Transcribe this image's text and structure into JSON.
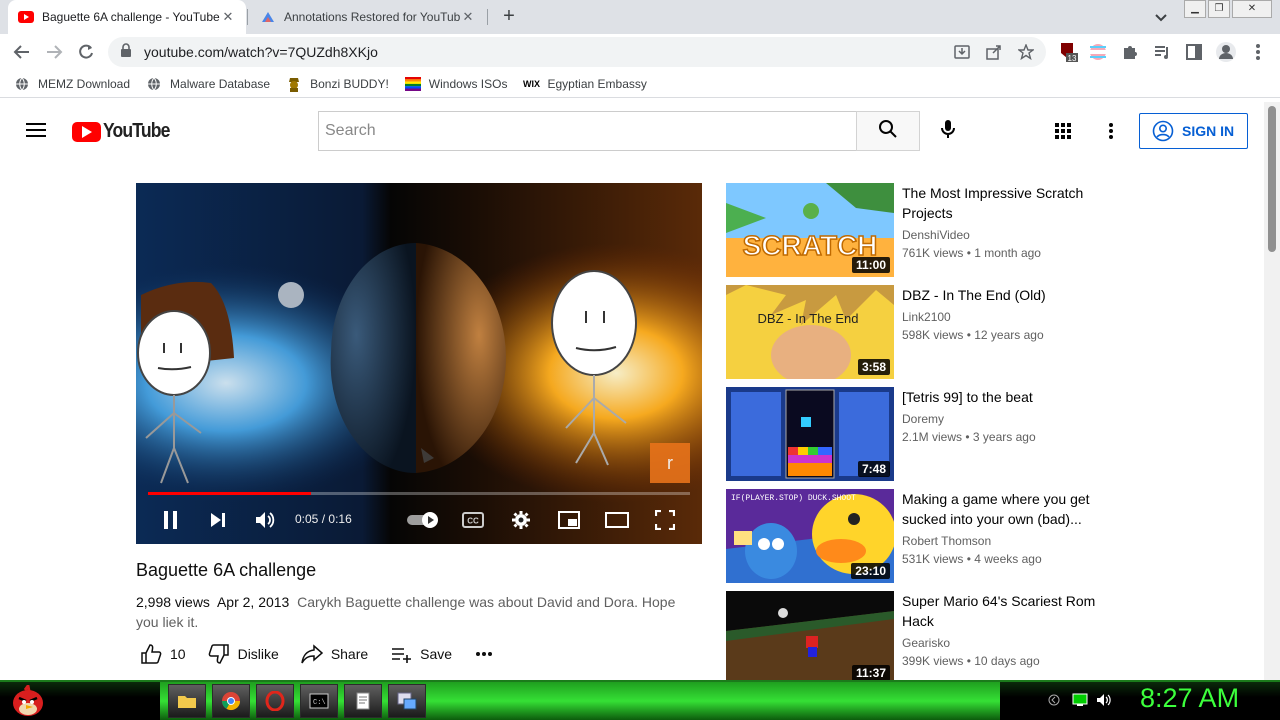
{
  "browser": {
    "tabs": [
      {
        "title": "Baguette 6A challenge - YouTube",
        "active": true
      },
      {
        "title": "Annotations Restored for YouTube",
        "active": false
      }
    ],
    "url": "youtube.com/watch?v=7QUZdh8XKjo",
    "extension_badge": "13",
    "bookmarks": [
      "MEMZ Download",
      "Malware Database",
      "Bonzi BUDDY!",
      "Windows ISOs",
      "Egyptian Embassy"
    ]
  },
  "youtube": {
    "logo_text": "YouTube",
    "search_placeholder": "Search",
    "sign_in_label": "SIGN IN"
  },
  "player": {
    "current_time": "0:05",
    "separator": "/",
    "duration": "0:16",
    "progress_fraction": 0.3,
    "overlay_badge": "r"
  },
  "video": {
    "title": "Baguette 6A challenge",
    "views": "2,998 views",
    "date": "Apr 2, 2013",
    "description": "Carykh Baguette challenge was about David and Dora. Hope you liek it.",
    "likes": "10",
    "dislike_label": "Dislike",
    "share_label": "Share",
    "save_label": "Save"
  },
  "recommendations": [
    {
      "title": "The Most Impressive Scratch Projects",
      "channel": "DenshiVideo",
      "views": "761K views",
      "age": "1 month ago",
      "duration": "11:00",
      "thumb_text": "SCRATCH"
    },
    {
      "title": "DBZ - In The End (Old)",
      "channel": "Link2100",
      "views": "598K views",
      "age": "12 years ago",
      "duration": "3:58",
      "thumb_text": "DBZ - In The End"
    },
    {
      "title": "[Tetris 99] to the beat",
      "channel": "Doremy",
      "views": "2.1M views",
      "age": "3 years ago",
      "duration": "7:48"
    },
    {
      "title": "Making a game where you get sucked into your own (bad)...",
      "channel": "Robert Thomson",
      "views": "531K views",
      "age": "4 weeks ago",
      "duration": "23:10",
      "thumb_text": "IF(PLAYER.STOP) DUCK.SHOOT"
    },
    {
      "title": "Super Mario 64's Scariest Rom Hack",
      "channel": "Gearisko",
      "views": "399K views",
      "age": "10 days ago",
      "duration": "11:37"
    }
  ],
  "taskbar": {
    "clock": "8:27 AM"
  }
}
